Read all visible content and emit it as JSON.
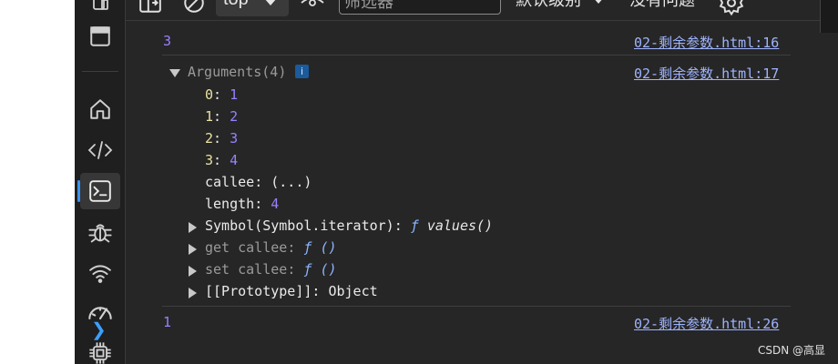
{
  "toolbar": {
    "context": "top",
    "filter_placeholder": "筛选器",
    "levels": "默认级别",
    "issues": "没有问题"
  },
  "messages": [
    {
      "value": "3",
      "source": "02-剩余参数.html:16"
    },
    {
      "source": "02-剩余参数.html:17"
    },
    {
      "value": "1",
      "source": "02-剩余参数.html:26"
    }
  ],
  "arguments": {
    "summary_label": "Arguments",
    "summary_count": "(4)",
    "badge": "i",
    "entries": [
      {
        "key": "0",
        "value": "1"
      },
      {
        "key": "1",
        "value": "2"
      },
      {
        "key": "2",
        "value": "3"
      },
      {
        "key": "3",
        "value": "4"
      }
    ],
    "callee_key": "callee",
    "callee_value": "(...)",
    "length_key": "length",
    "length_value": "4",
    "symbol_key": "Symbol(Symbol.iterator)",
    "symbol_f": "ƒ",
    "symbol_fn": "values()",
    "get_callee_key": "get callee",
    "get_callee_f": "ƒ",
    "get_callee_fn": "()",
    "set_callee_key": "set callee",
    "set_callee_f": "ƒ",
    "set_callee_fn": "()",
    "proto_key": "[[Prototype]]",
    "proto_value": "Object"
  },
  "prompt_symbol": "❯",
  "watermark": "CSDN @高显"
}
